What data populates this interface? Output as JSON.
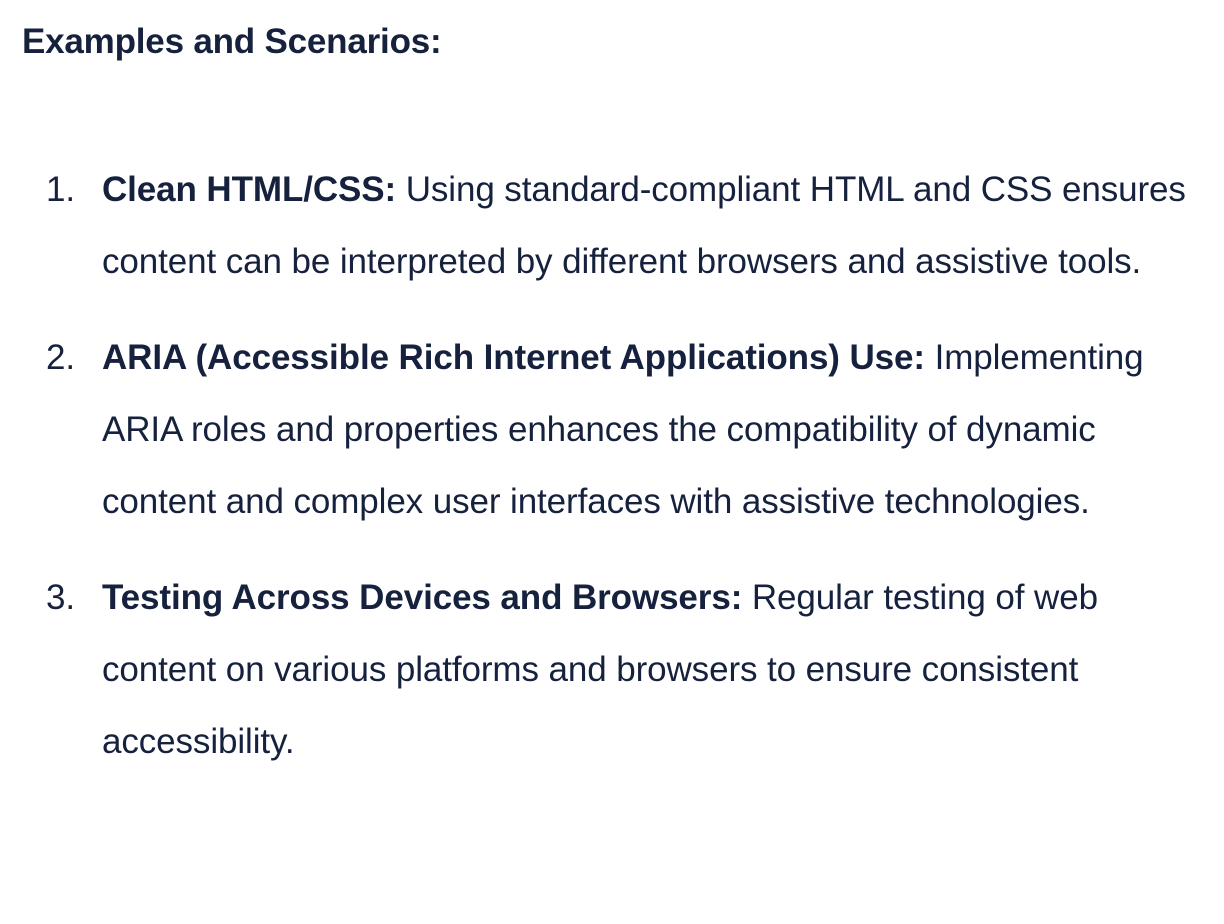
{
  "heading": "Examples and Scenarios:",
  "items": [
    {
      "number": "1.",
      "lead": "Clean HTML/CSS:",
      "text": " Using standard-compliant HTML and CSS ensures content can be interpreted by different browsers and assistive tools."
    },
    {
      "number": "2.",
      "lead": "ARIA (Accessible Rich Internet Applications) Use:",
      "text": " Implementing ARIA roles and properties enhances the compatibility of dynamic content and complex user interfaces with assistive technologies."
    },
    {
      "number": "3.",
      "lead": "Testing Across Devices and Browsers:",
      "text": " Regular testing of web content on various platforms and browsers to ensure consistent accessibility."
    }
  ]
}
